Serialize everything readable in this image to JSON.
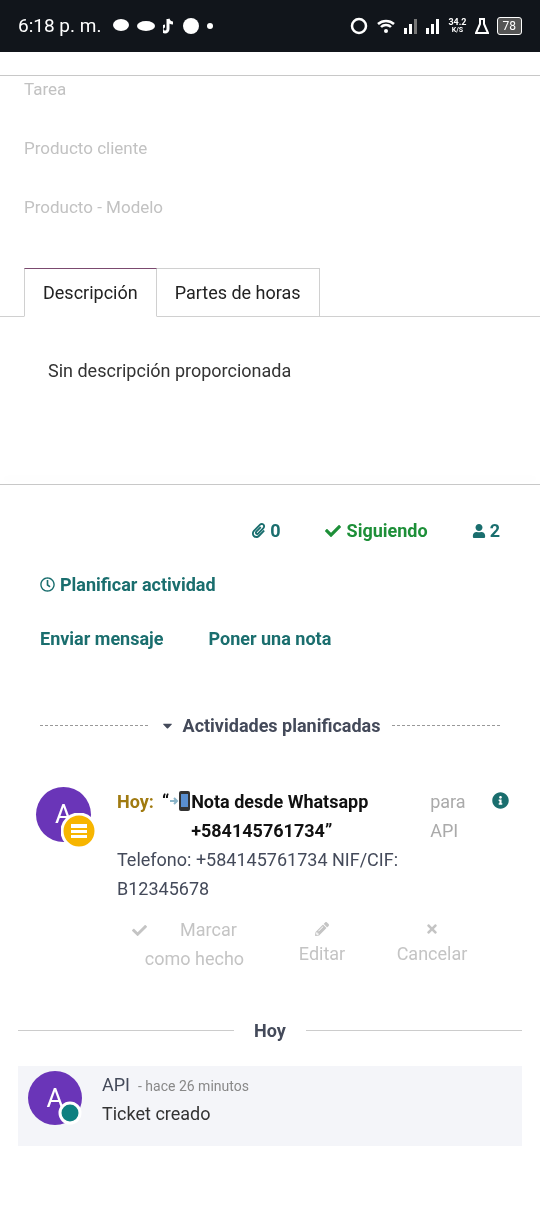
{
  "status_bar": {
    "time": "6:18 p. m.",
    "speed": "34.2",
    "speed_unit": "K/S",
    "battery": "78"
  },
  "fields": [
    {
      "label": "Tarea"
    },
    {
      "label": "Producto cliente"
    },
    {
      "label": "Producto - Modelo"
    }
  ],
  "tabs": [
    {
      "label": "Descripción",
      "selected": true
    },
    {
      "label": "Partes de horas",
      "selected": false
    }
  ],
  "description": "Sin descripción proporcionada",
  "chatter": {
    "attachments": "0",
    "follow": "Siguiendo",
    "followers": "2",
    "schedule": "Planificar actividad",
    "send_message": "Enviar mensaje",
    "log_note": "Poner una nota"
  },
  "activities": {
    "heading": "Actividades planificadas",
    "expanded": true,
    "items": [
      {
        "avatar": "A",
        "when": "Hoy:",
        "quote_open": "“",
        "title": "Nota desde Whatsapp +584145761734”",
        "assignee_prefix": "para",
        "assignee": "API",
        "note": "Telefono: +584145761734 NIF/CIF: B12345678",
        "actions": [
          "Marcar como hecho",
          "Editar",
          "Cancelar"
        ]
      }
    ]
  },
  "separator": "Hoy",
  "messages": [
    {
      "avatar": "A",
      "author": "API",
      "time": "- hace 26 minutos",
      "body": "Ticket creado"
    }
  ]
}
